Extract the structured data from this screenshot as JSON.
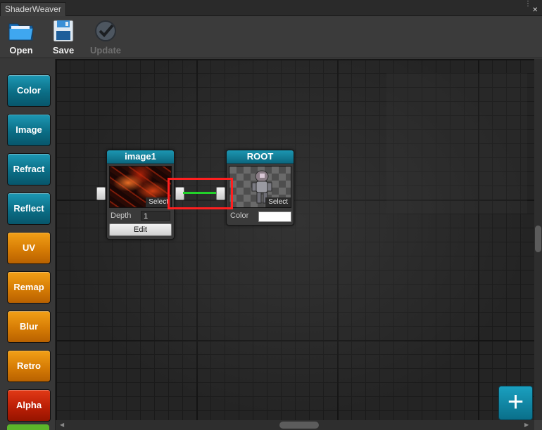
{
  "window": {
    "title": "ShaderWeaver"
  },
  "toolbar": {
    "open_label": "Open",
    "save_label": "Save",
    "update_label": "Update"
  },
  "palette": {
    "items": [
      {
        "label": "Color",
        "color": "blue"
      },
      {
        "label": "Image",
        "color": "blue"
      },
      {
        "label": "Refract",
        "color": "blue"
      },
      {
        "label": "Reflect",
        "color": "blue"
      },
      {
        "label": "UV",
        "color": "orange"
      },
      {
        "label": "Remap",
        "color": "orange"
      },
      {
        "label": "Blur",
        "color": "orange"
      },
      {
        "label": "Retro",
        "color": "orange"
      },
      {
        "label": "Alpha",
        "color": "red"
      }
    ]
  },
  "nodes": {
    "image1": {
      "title": "image1",
      "select_label": "Select",
      "depth_label": "Depth",
      "depth_value": "1",
      "edit_label": "Edit"
    },
    "root": {
      "title": "ROOT",
      "select_label": "Select",
      "color_label": "Color",
      "color_value": "#ffffff"
    }
  },
  "colors": {
    "wire": "#22d12a",
    "highlight": "#ff1f1f",
    "node_header": "#0c6880"
  },
  "add_button": {
    "label": "+"
  }
}
